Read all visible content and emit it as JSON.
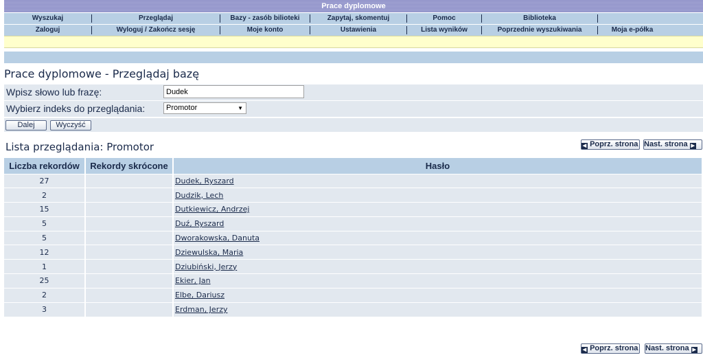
{
  "header": {
    "title": "Prace dyplomowe"
  },
  "nav": {
    "row1": [
      "Wyszukaj",
      "Przeglądaj",
      "Bazy - zasób bilioteki",
      "Zapytaj, skomentuj",
      "Pomoc",
      "Biblioteka"
    ],
    "row2": [
      "Zaloguj",
      "Wyloguj / Zakończ sesję",
      "Moje konto",
      "Ustawienia",
      "Lista wyników",
      "Poprzednie wyszukiwania",
      "Moja e-półka"
    ]
  },
  "page": {
    "title": "Prace dyplomowe - Przeglądaj bazę"
  },
  "form": {
    "phrase_label": "Wpisz słowo lub frazę:",
    "phrase_value": "Dudek",
    "index_label": "Wybierz indeks do przeglądania:",
    "index_value": "Promotor",
    "next_button": "Dalej",
    "clear_button": "Wyczyść"
  },
  "list": {
    "title": "Lista przeglądania: Promotor",
    "prev_page": "Poprz. strona",
    "next_page": "Nast. strona",
    "columns": [
      "Liczba rekordów",
      "Rekordy skrócone",
      "Hasło"
    ],
    "rows": [
      {
        "count": "27",
        "short": "",
        "entry": "Dudek, Ryszard"
      },
      {
        "count": "2",
        "short": "",
        "entry": "Dudzik, Lech"
      },
      {
        "count": "15",
        "short": "",
        "entry": "Dutkiewicz, Andrzej"
      },
      {
        "count": "5",
        "short": "",
        "entry": "Duź, Ryszard"
      },
      {
        "count": "5",
        "short": "",
        "entry": "Dworakowska, Danuta"
      },
      {
        "count": "12",
        "short": "",
        "entry": "Dziewulska, Maria"
      },
      {
        "count": "1",
        "short": "",
        "entry": "Dziubiński, Jerzy"
      },
      {
        "count": "25",
        "short": "",
        "entry": "Ekier, Jan"
      },
      {
        "count": "2",
        "short": "",
        "entry": "Elbe, Dariusz"
      },
      {
        "count": "3",
        "short": "",
        "entry": "Erdman, Jerzy"
      }
    ]
  }
}
